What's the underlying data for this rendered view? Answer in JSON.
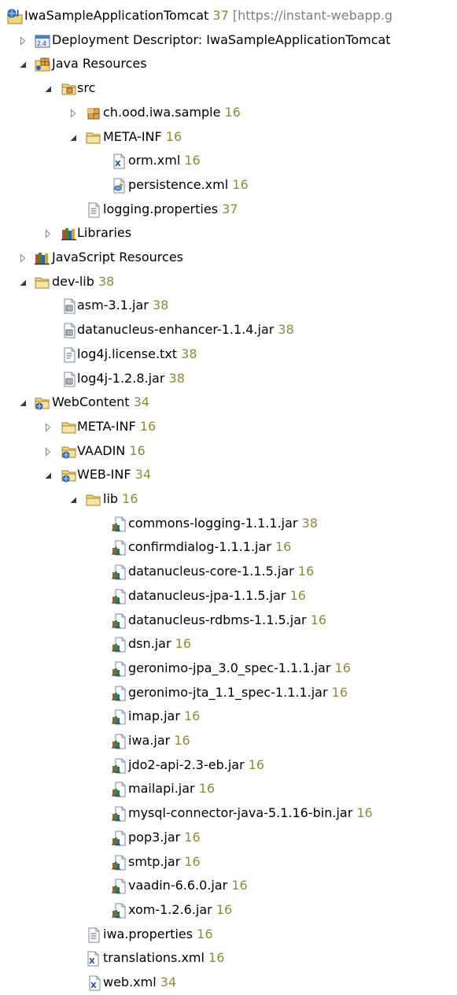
{
  "colors": {
    "revision": "#8e8a3c",
    "suffix": "#7f7f7f"
  },
  "tree": [
    {
      "label": "IwaSampleApplicationTomcat",
      "rev": "37",
      "suffix": "[https://instant-webapp.g",
      "icon": "web-project-icon",
      "twisty": "none",
      "level": 0
    },
    {
      "label": "Deployment Descriptor: IwaSampleApplicationTomcat",
      "rev": "",
      "icon": "deployment-descriptor-icon",
      "twisty": "collapsed",
      "level": 1
    },
    {
      "label": "Java Resources",
      "rev": "",
      "icon": "java-resources-icon",
      "twisty": "expanded",
      "level": 1
    },
    {
      "label": "src",
      "rev": "",
      "icon": "source-folder-icon",
      "twisty": "expanded",
      "level": 2
    },
    {
      "label": "ch.ood.iwa.sample",
      "rev": "16",
      "icon": "package-icon",
      "twisty": "collapsed",
      "level": 3
    },
    {
      "label": "META-INF",
      "rev": "16",
      "icon": "folder-icon",
      "twisty": "expanded",
      "level": 3
    },
    {
      "label": "orm.xml",
      "rev": "16",
      "icon": "xml-file-icon",
      "twisty": "none",
      "level": 4
    },
    {
      "label": "persistence.xml",
      "rev": "16",
      "icon": "persistence-file-icon",
      "twisty": "none",
      "level": 4
    },
    {
      "label": "logging.properties",
      "rev": "37",
      "icon": "properties-file-icon",
      "twisty": "none",
      "level": 3
    },
    {
      "label": "Libraries",
      "rev": "",
      "icon": "libraries-icon",
      "twisty": "collapsed",
      "level": 2
    },
    {
      "label": "JavaScript Resources",
      "rev": "",
      "icon": "libraries-icon",
      "twisty": "collapsed",
      "level": 1
    },
    {
      "label": "dev-lib",
      "rev": "38",
      "icon": "folder-icon",
      "twisty": "expanded",
      "level": 1
    },
    {
      "label": "asm-3.1.jar",
      "rev": "38",
      "icon": "jar-file-icon",
      "twisty": "none",
      "level": 2
    },
    {
      "label": "datanucleus-enhancer-1.1.4.jar",
      "rev": "38",
      "icon": "jar-file-icon",
      "twisty": "none",
      "level": 2
    },
    {
      "label": "log4j.license.txt",
      "rev": "38",
      "icon": "text-file-icon",
      "twisty": "none",
      "level": 2
    },
    {
      "label": "log4j-1.2.8.jar",
      "rev": "38",
      "icon": "jar-file-icon",
      "twisty": "none",
      "level": 2
    },
    {
      "label": "WebContent",
      "rev": "34",
      "icon": "web-folder-icon",
      "twisty": "expanded",
      "level": 1
    },
    {
      "label": "META-INF",
      "rev": "16",
      "icon": "folder-icon",
      "twisty": "collapsed",
      "level": 2
    },
    {
      "label": "VAADIN",
      "rev": "16",
      "icon": "web-folder-icon",
      "twisty": "collapsed",
      "level": 2
    },
    {
      "label": "WEB-INF",
      "rev": "34",
      "icon": "web-folder-icon",
      "twisty": "expanded",
      "level": 2
    },
    {
      "label": "lib",
      "rev": "16",
      "icon": "folder-icon",
      "twisty": "expanded",
      "level": 3
    },
    {
      "label": "commons-logging-1.1.1.jar",
      "rev": "38",
      "icon": "library-jar-icon",
      "twisty": "none",
      "level": 4
    },
    {
      "label": "confirmdialog-1.1.1.jar",
      "rev": "16",
      "icon": "library-jar-icon",
      "twisty": "none",
      "level": 4
    },
    {
      "label": "datanucleus-core-1.1.5.jar",
      "rev": "16",
      "icon": "library-jar-icon",
      "twisty": "none",
      "level": 4
    },
    {
      "label": "datanucleus-jpa-1.1.5.jar",
      "rev": "16",
      "icon": "library-jar-icon",
      "twisty": "none",
      "level": 4
    },
    {
      "label": "datanucleus-rdbms-1.1.5.jar",
      "rev": "16",
      "icon": "library-jar-icon",
      "twisty": "none",
      "level": 4
    },
    {
      "label": "dsn.jar",
      "rev": "16",
      "icon": "library-jar-icon",
      "twisty": "none",
      "level": 4
    },
    {
      "label": "geronimo-jpa_3.0_spec-1.1.1.jar",
      "rev": "16",
      "icon": "library-jar-icon",
      "twisty": "none",
      "level": 4
    },
    {
      "label": "geronimo-jta_1.1_spec-1.1.1.jar",
      "rev": "16",
      "icon": "library-jar-icon",
      "twisty": "none",
      "level": 4
    },
    {
      "label": "imap.jar",
      "rev": "16",
      "icon": "library-jar-icon",
      "twisty": "none",
      "level": 4
    },
    {
      "label": "iwa.jar",
      "rev": "16",
      "icon": "library-jar-icon",
      "twisty": "none",
      "level": 4
    },
    {
      "label": "jdo2-api-2.3-eb.jar",
      "rev": "16",
      "icon": "library-jar-icon",
      "twisty": "none",
      "level": 4
    },
    {
      "label": "mailapi.jar",
      "rev": "16",
      "icon": "library-jar-icon",
      "twisty": "none",
      "level": 4
    },
    {
      "label": "mysql-connector-java-5.1.16-bin.jar",
      "rev": "16",
      "icon": "library-jar-icon",
      "twisty": "none",
      "level": 4
    },
    {
      "label": "pop3.jar",
      "rev": "16",
      "icon": "library-jar-icon",
      "twisty": "none",
      "level": 4
    },
    {
      "label": "smtp.jar",
      "rev": "16",
      "icon": "library-jar-icon",
      "twisty": "none",
      "level": 4
    },
    {
      "label": "vaadin-6.6.0.jar",
      "rev": "16",
      "icon": "library-jar-icon",
      "twisty": "none",
      "level": 4
    },
    {
      "label": "xom-1.2.6.jar",
      "rev": "16",
      "icon": "library-jar-icon",
      "twisty": "none",
      "level": 4
    },
    {
      "label": "iwa.properties",
      "rev": "16",
      "icon": "properties-file-icon",
      "twisty": "none",
      "level": 3
    },
    {
      "label": "translations.xml",
      "rev": "16",
      "icon": "xml-file-icon",
      "twisty": "none",
      "level": 2
    },
    {
      "label": "web.xml",
      "rev": "34",
      "icon": "xml-file-icon",
      "twisty": "none",
      "level": 3
    }
  ]
}
